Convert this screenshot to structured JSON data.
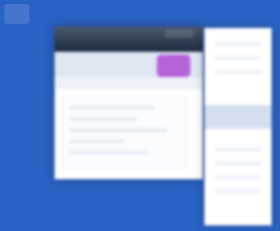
{
  "desktop": {
    "background_color": "#2a63c5",
    "icon": "desktop-shortcut-icon"
  },
  "main_window": {
    "titlebar_color": "#1c2a3f",
    "toolbar_color": "#dfe7f3",
    "accent_color": "#b763d8"
  },
  "side_panel": {
    "highlight_color": "#d4dff0"
  }
}
